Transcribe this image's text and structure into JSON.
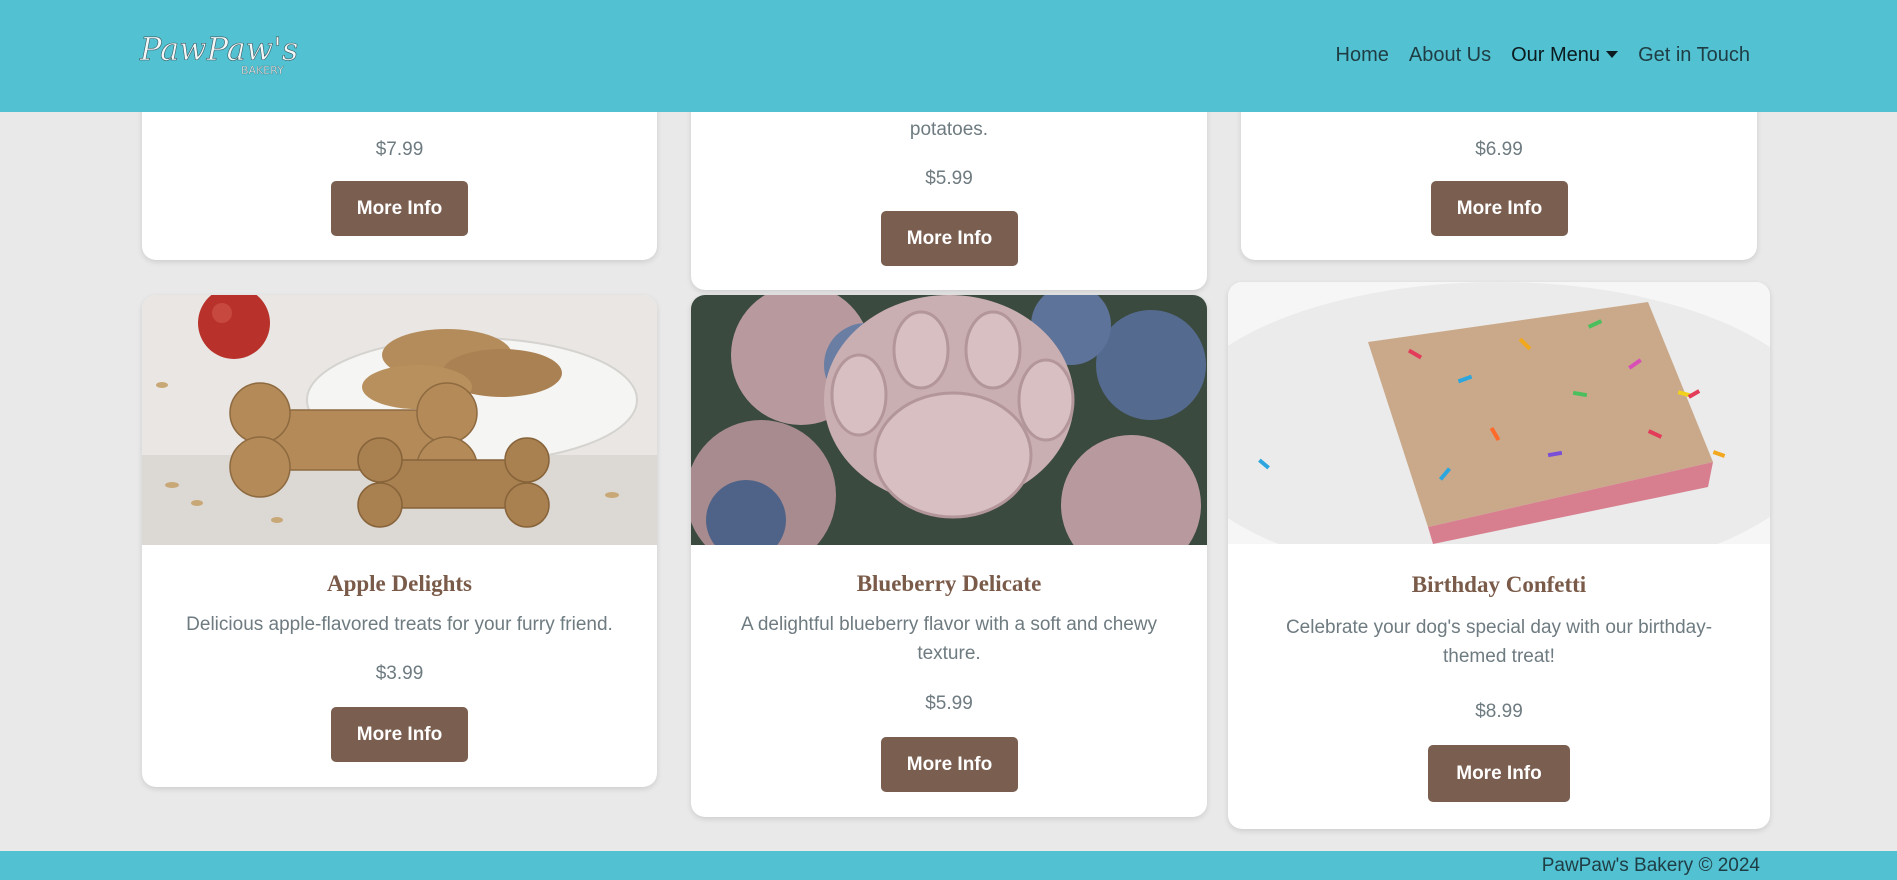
{
  "brand": {
    "logo_alt": "PawPaw's Bakery"
  },
  "nav": {
    "items": [
      {
        "label": "Home"
      },
      {
        "label": "About Us"
      },
      {
        "label": "Our Menu"
      },
      {
        "label": "Get in Touch"
      }
    ]
  },
  "top_cards": [
    {
      "desc": "",
      "price": "$7.99",
      "button": "More Info"
    },
    {
      "desc": "potatoes.",
      "price": "$5.99",
      "button": "More Info"
    },
    {
      "desc": "",
      "price": "$6.99",
      "button": "More Info"
    }
  ],
  "products": [
    {
      "title": "Apple Delights",
      "desc": "Delicious apple-flavored treats for your furry friend.",
      "price": "$3.99",
      "button": "More Info"
    },
    {
      "title": "Blueberry Delicate",
      "desc": "A delightful blueberry flavor with a soft and chewy texture.",
      "price": "$5.99",
      "button": "More Info"
    },
    {
      "title": "Birthday Confetti",
      "desc": "Celebrate your dog's special day with our birthday-themed treat!",
      "price": "$8.99",
      "button": "More Info"
    }
  ],
  "footer": {
    "text": "PawPaw's Bakery © 2024"
  },
  "colors": {
    "header": "#52c1d1",
    "button": "#7a5e4f",
    "title": "#7a5a48",
    "background": "#e9e9e9"
  }
}
